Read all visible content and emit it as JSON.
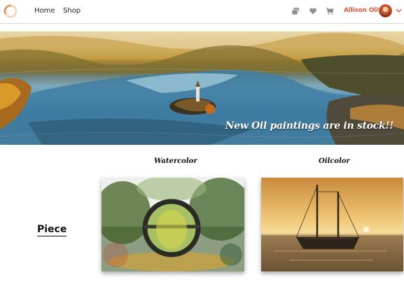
{
  "header": {
    "logo_icon": "spinner-ring-icon",
    "nav": [
      {
        "label": "Home"
      },
      {
        "label": "Shop"
      }
    ],
    "icons": [
      "stack-icon",
      "heart-icon",
      "cart-icon"
    ],
    "user": {
      "name": "Allison Olivia",
      "menu_icon": "chevron-down-icon"
    },
    "accent_color": "#e0593a"
  },
  "banner": {
    "caption": "New Oil paintings are in stock!!"
  },
  "gallery": {
    "row_label": "Piece",
    "columns": [
      {
        "title": "Watercolor"
      },
      {
        "title": "Oilcolor"
      }
    ]
  }
}
